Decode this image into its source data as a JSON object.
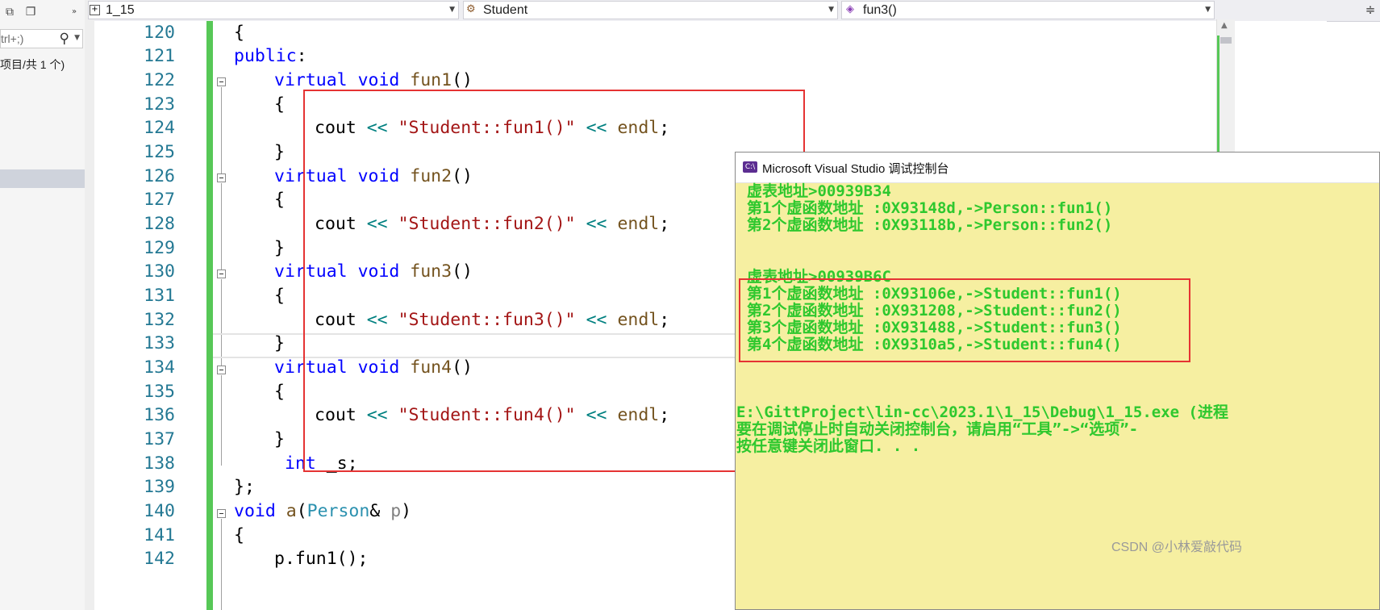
{
  "left_panel": {
    "search_placeholder": "trl+;)",
    "status_text": "项目/共 1 个)"
  },
  "navbar": {
    "project": "1_15",
    "class": "Student",
    "member": "fun3()"
  },
  "editor": {
    "line_numbers": [
      "120",
      "121",
      "122",
      "123",
      "124",
      "125",
      "126",
      "127",
      "128",
      "129",
      "130",
      "131",
      "132",
      "133",
      "134",
      "135",
      "136",
      "137",
      "138",
      "139",
      "140",
      "141",
      "142"
    ],
    "code": {
      "l120": "{",
      "l121_kw": "public",
      "l121_rest": ":",
      "virtual": "virtual",
      "void": "void",
      "fun1": "fun1",
      "fun2": "fun2",
      "fun3": "fun3",
      "fun4": "fun4",
      "parens": "()",
      "open_brace": "{",
      "close_brace": "}",
      "cout": "cout",
      "shift": "<<",
      "str1": "\"Student::fun1()\"",
      "str2": "\"Student::fun2()\"",
      "str3": "\"Student::fun3()\"",
      "str4": "\"Student::fun4()\"",
      "endl": "endl",
      "semi": ";",
      "int": "int",
      "member": " _s;",
      "class_end": "};",
      "a": "a",
      "person": "Person",
      "amp": "& ",
      "p": "p",
      "close_paren": ")",
      "open_paren": "(",
      "l142": "p.fun1();"
    }
  },
  "console": {
    "title": "Microsoft Visual Studio 调试控制台",
    "icon_text": "C:\\",
    "lines": [
      "虚表地址>00939B34",
      "第1个虚函数地址 :0X93148d,->Person::fun1()",
      "第2个虚函数地址 :0X93118b,->Person::fun2()",
      "",
      "",
      "虚表地址>00939B6C",
      "第1个虚函数地址 :0X93106e,->Student::fun1()",
      "第2个虚函数地址 :0X931208,->Student::fun2()",
      "第3个虚函数地址 :0X931488,->Student::fun3()",
      "第4个虚函数地址 :0X9310a5,->Student::fun4()",
      "",
      "",
      "",
      "E:\\GittProject\\lin-cc\\2023.1\\1_15\\Debug\\1_15.exe (进程 ",
      "要在调试停止时自动关闭控制台，请启用“工具”->“选项”-",
      "按任意键关闭此窗口. . ."
    ]
  },
  "watermark": "CSDN @小林爱敲代码",
  "colors": {
    "keyword": "#0000ff",
    "string": "#a31515",
    "function": "#74531f",
    "type": "#2b91af",
    "console_text": "#2ec82e",
    "console_bg": "#f6efa1",
    "highlight_box": "#e53333"
  }
}
